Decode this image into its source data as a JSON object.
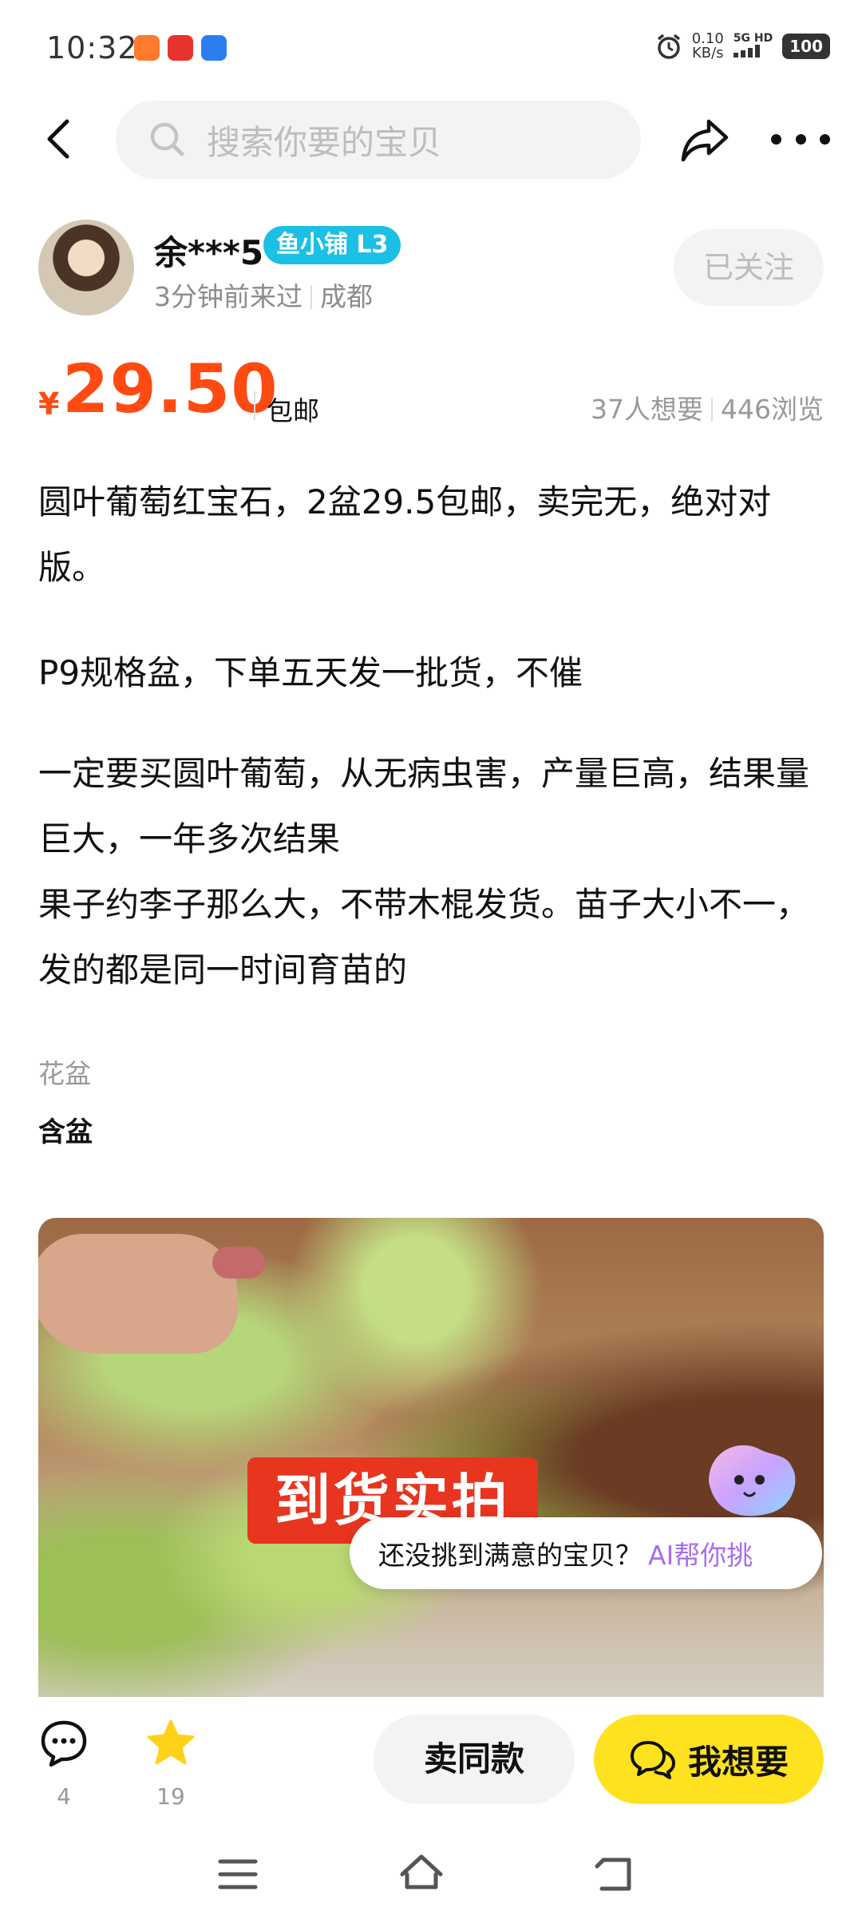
{
  "status_bar": {
    "time": "10:32",
    "net_speed": "0.10",
    "net_unit": "KB/s",
    "network": "5G HD",
    "battery": "100"
  },
  "header": {
    "search_placeholder": "搜索你要的宝贝",
    "icons": [
      "back-icon",
      "search-icon",
      "share-icon",
      "more-icon"
    ]
  },
  "seller": {
    "name": "余***5",
    "badge": "鱼小铺 L3",
    "last_seen": "3分钟前来过",
    "location": "成都",
    "follow_label": "已关注"
  },
  "price": {
    "currency": "¥",
    "amount": "29.50",
    "shipping": "包邮",
    "wants": "37人想要",
    "views": "446浏览",
    "color": "#ff4a12"
  },
  "description": {
    "p1": "圆叶葡萄红宝石，2盆29.5包邮，卖完无，绝对对版。",
    "p2": "P9规格盆，下单五天发一批货，不催",
    "p3_line1": "一定要买圆叶葡萄，从无病虫害，产量巨高，结果量巨大，一年多次结果",
    "p3_line2": "果子约李子那么大，不带木棍发货。苗子大小不一，发的都是同一时间育苗的"
  },
  "attribute": {
    "label": "花盆",
    "value": "含盆"
  },
  "photo": {
    "banner_text": "到货实拍"
  },
  "ai_prompt": {
    "text": "还没挑到满意的宝贝？",
    "link": "AI帮你挑"
  },
  "actions": {
    "comment_count": "4",
    "favorite_count": "19",
    "sell_same_label": "卖同款",
    "want_label": "我想要",
    "accent": "#ffe21f"
  }
}
